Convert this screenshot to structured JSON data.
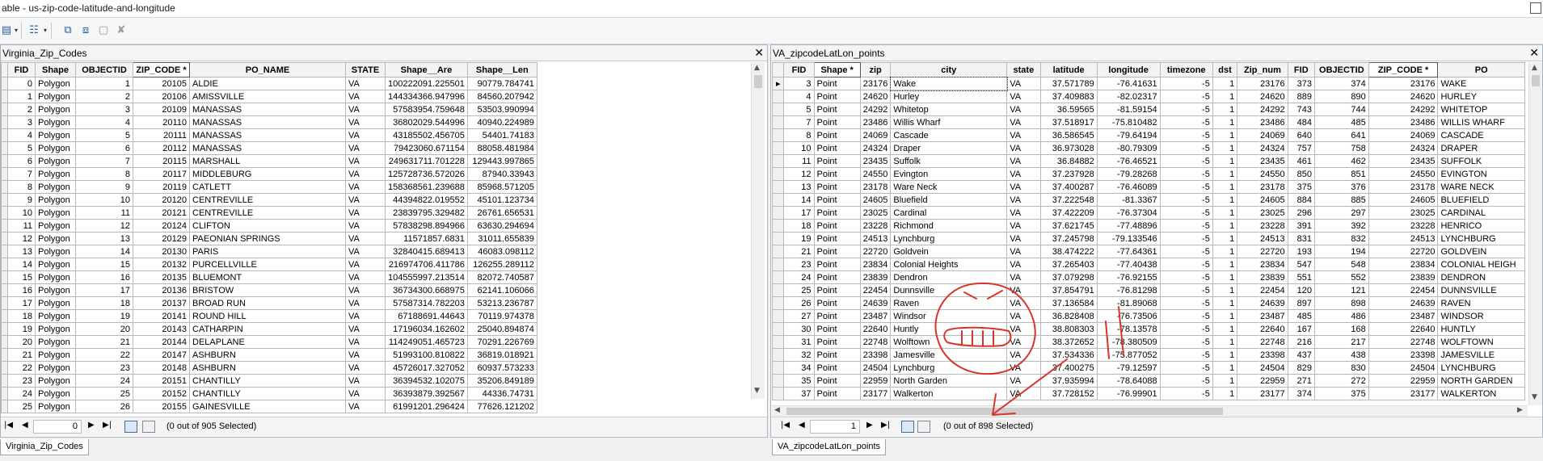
{
  "window": {
    "title": "able - us-zip-code-latitude-and-longitude"
  },
  "left": {
    "title": "Virginia_Zip_Codes",
    "columns": [
      "FID",
      "Shape",
      "OBJECTID",
      "ZIP_CODE *",
      "PO_NAME",
      "STATE",
      "Shape__Are",
      "Shape__Len"
    ],
    "rows": [
      [
        "0",
        "Polygon",
        "1",
        "20105",
        "ALDIE",
        "VA",
        "100222091.225501",
        "90779.784741"
      ],
      [
        "1",
        "Polygon",
        "2",
        "20106",
        "AMISSVILLE",
        "VA",
        "144334366.947996",
        "84560.207942"
      ],
      [
        "2",
        "Polygon",
        "3",
        "20109",
        "MANASSAS",
        "VA",
        "57583954.759648",
        "53503.990994"
      ],
      [
        "3",
        "Polygon",
        "4",
        "20110",
        "MANASSAS",
        "VA",
        "36802029.544996",
        "40940.224989"
      ],
      [
        "4",
        "Polygon",
        "5",
        "20111",
        "MANASSAS",
        "VA",
        "43185502.456705",
        "54401.74183"
      ],
      [
        "5",
        "Polygon",
        "6",
        "20112",
        "MANASSAS",
        "VA",
        "79423060.671154",
        "88058.481984"
      ],
      [
        "6",
        "Polygon",
        "7",
        "20115",
        "MARSHALL",
        "VA",
        "249631711.701228",
        "129443.997865"
      ],
      [
        "7",
        "Polygon",
        "8",
        "20117",
        "MIDDLEBURG",
        "VA",
        "125728736.572026",
        "87940.33943"
      ],
      [
        "8",
        "Polygon",
        "9",
        "20119",
        "CATLETT",
        "VA",
        "158368561.239688",
        "85968.571205"
      ],
      [
        "9",
        "Polygon",
        "10",
        "20120",
        "CENTREVILLE",
        "VA",
        "44394822.019552",
        "45101.123734"
      ],
      [
        "10",
        "Polygon",
        "11",
        "20121",
        "CENTREVILLE",
        "VA",
        "23839795.329482",
        "26761.656531"
      ],
      [
        "11",
        "Polygon",
        "12",
        "20124",
        "CLIFTON",
        "VA",
        "57838298.894966",
        "63630.294694"
      ],
      [
        "12",
        "Polygon",
        "13",
        "20129",
        "PAEONIAN SPRINGS",
        "VA",
        "11571857.6831",
        "31011.655839"
      ],
      [
        "13",
        "Polygon",
        "14",
        "20130",
        "PARIS",
        "VA",
        "32840415.689413",
        "46083.098112"
      ],
      [
        "14",
        "Polygon",
        "15",
        "20132",
        "PURCELLVILLE",
        "VA",
        "216974706.411786",
        "126255.289112"
      ],
      [
        "15",
        "Polygon",
        "16",
        "20135",
        "BLUEMONT",
        "VA",
        "104555997.213514",
        "82072.740587"
      ],
      [
        "16",
        "Polygon",
        "17",
        "20136",
        "BRISTOW",
        "VA",
        "36734300.668975",
        "62141.106066"
      ],
      [
        "17",
        "Polygon",
        "18",
        "20137",
        "BROAD RUN",
        "VA",
        "57587314.782203",
        "53213.236787"
      ],
      [
        "18",
        "Polygon",
        "19",
        "20141",
        "ROUND HILL",
        "VA",
        "67188691.44643",
        "70119.974378"
      ],
      [
        "19",
        "Polygon",
        "20",
        "20143",
        "CATHARPIN",
        "VA",
        "17196034.162602",
        "25040.894874"
      ],
      [
        "20",
        "Polygon",
        "21",
        "20144",
        "DELAPLANE",
        "VA",
        "114249051.465723",
        "70291.226769"
      ],
      [
        "21",
        "Polygon",
        "22",
        "20147",
        "ASHBURN",
        "VA",
        "51993100.810822",
        "36819.018921"
      ],
      [
        "22",
        "Polygon",
        "23",
        "20148",
        "ASHBURN",
        "VA",
        "45726017.327052",
        "60937.573233"
      ],
      [
        "23",
        "Polygon",
        "24",
        "20151",
        "CHANTILLY",
        "VA",
        "36394532.102075",
        "35206.849189"
      ],
      [
        "24",
        "Polygon",
        "25",
        "20152",
        "CHANTILLY",
        "VA",
        "36393879.392567",
        "44336.74731"
      ],
      [
        "25",
        "Polygon",
        "26",
        "20155",
        "GAINESVILLE",
        "VA",
        "61991201.296424",
        "77626.121202"
      ]
    ],
    "nav": {
      "record": "0",
      "selection": "(0 out of 905 Selected)"
    },
    "tab_label": "Virginia_Zip_Codes"
  },
  "right": {
    "title": "VA_zipcodeLatLon_points",
    "columns": [
      "FID",
      "Shape *",
      "zip",
      "city",
      "state",
      "latitude",
      "longitude",
      "timezone",
      "dst",
      "Zip_num",
      "FID",
      "OBJECTID",
      "ZIP_CODE *",
      "PO"
    ],
    "rows": [
      [
        "3",
        "Point",
        "23176",
        "Wake",
        "VA",
        "37.571789",
        "-76.41631",
        "-5",
        "1",
        "23176",
        "373",
        "374",
        "23176",
        "WAKE"
      ],
      [
        "4",
        "Point",
        "24620",
        "Hurley",
        "VA",
        "37.409883",
        "-82.02317",
        "-5",
        "1",
        "24620",
        "889",
        "890",
        "24620",
        "HURLEY"
      ],
      [
        "5",
        "Point",
        "24292",
        "Whitetop",
        "VA",
        "36.59565",
        "-81.59154",
        "-5",
        "1",
        "24292",
        "743",
        "744",
        "24292",
        "WHITETOP"
      ],
      [
        "7",
        "Point",
        "23486",
        "Willis Wharf",
        "VA",
        "37.518917",
        "-75.810482",
        "-5",
        "1",
        "23486",
        "484",
        "485",
        "23486",
        "WILLIS WHARF"
      ],
      [
        "8",
        "Point",
        "24069",
        "Cascade",
        "VA",
        "36.586545",
        "-79.64194",
        "-5",
        "1",
        "24069",
        "640",
        "641",
        "24069",
        "CASCADE"
      ],
      [
        "10",
        "Point",
        "24324",
        "Draper",
        "VA",
        "36.973028",
        "-80.79309",
        "-5",
        "1",
        "24324",
        "757",
        "758",
        "24324",
        "DRAPER"
      ],
      [
        "11",
        "Point",
        "23435",
        "Suffolk",
        "VA",
        "36.84882",
        "-76.46521",
        "-5",
        "1",
        "23435",
        "461",
        "462",
        "23435",
        "SUFFOLK"
      ],
      [
        "12",
        "Point",
        "24550",
        "Evington",
        "VA",
        "37.237928",
        "-79.28268",
        "-5",
        "1",
        "24550",
        "850",
        "851",
        "24550",
        "EVINGTON"
      ],
      [
        "13",
        "Point",
        "23178",
        "Ware Neck",
        "VA",
        "37.400287",
        "-76.46089",
        "-5",
        "1",
        "23178",
        "375",
        "376",
        "23178",
        "WARE NECK"
      ],
      [
        "14",
        "Point",
        "24605",
        "Bluefield",
        "VA",
        "37.222548",
        "-81.3367",
        "-5",
        "1",
        "24605",
        "884",
        "885",
        "24605",
        "BLUEFIELD"
      ],
      [
        "17",
        "Point",
        "23025",
        "Cardinal",
        "VA",
        "37.422209",
        "-76.37304",
        "-5",
        "1",
        "23025",
        "296",
        "297",
        "23025",
        "CARDINAL"
      ],
      [
        "18",
        "Point",
        "23228",
        "Richmond",
        "VA",
        "37.621745",
        "-77.48896",
        "-5",
        "1",
        "23228",
        "391",
        "392",
        "23228",
        "HENRICO"
      ],
      [
        "19",
        "Point",
        "24513",
        "Lynchburg",
        "VA",
        "37.245798",
        "-79.133546",
        "-5",
        "1",
        "24513",
        "831",
        "832",
        "24513",
        "LYNCHBURG"
      ],
      [
        "21",
        "Point",
        "22720",
        "Goldvein",
        "VA",
        "38.474222",
        "-77.64361",
        "-5",
        "1",
        "22720",
        "193",
        "194",
        "22720",
        "GOLDVEIN"
      ],
      [
        "23",
        "Point",
        "23834",
        "Colonial Heights",
        "VA",
        "37.265403",
        "-77.40438",
        "-5",
        "1",
        "23834",
        "547",
        "548",
        "23834",
        "COLONIAL HEIGH"
      ],
      [
        "24",
        "Point",
        "23839",
        "Dendron",
        "VA",
        "37.079298",
        "-76.92155",
        "-5",
        "1",
        "23839",
        "551",
        "552",
        "23839",
        "DENDRON"
      ],
      [
        "25",
        "Point",
        "22454",
        "Dunnsville",
        "VA",
        "37.854791",
        "-76.81298",
        "-5",
        "1",
        "22454",
        "120",
        "121",
        "22454",
        "DUNNSVILLE"
      ],
      [
        "26",
        "Point",
        "24639",
        "Raven",
        "VA",
        "37.136584",
        "-81.89068",
        "-5",
        "1",
        "24639",
        "897",
        "898",
        "24639",
        "RAVEN"
      ],
      [
        "27",
        "Point",
        "23487",
        "Windsor",
        "VA",
        "36.828408",
        "-76.73506",
        "-5",
        "1",
        "23487",
        "485",
        "486",
        "23487",
        "WINDSOR"
      ],
      [
        "30",
        "Point",
        "22640",
        "Huntly",
        "VA",
        "38.808303",
        "-78.13578",
        "-5",
        "1",
        "22640",
        "167",
        "168",
        "22640",
        "HUNTLY"
      ],
      [
        "31",
        "Point",
        "22748",
        "Wolftown",
        "VA",
        "38.372652",
        "-78.380509",
        "-5",
        "1",
        "22748",
        "216",
        "217",
        "22748",
        "WOLFTOWN"
      ],
      [
        "32",
        "Point",
        "23398",
        "Jamesville",
        "VA",
        "37.534336",
        "-75.877052",
        "-5",
        "1",
        "23398",
        "437",
        "438",
        "23398",
        "JAMESVILLE"
      ],
      [
        "34",
        "Point",
        "24504",
        "Lynchburg",
        "VA",
        "37.400275",
        "-79.12597",
        "-5",
        "1",
        "24504",
        "829",
        "830",
        "24504",
        "LYNCHBURG"
      ],
      [
        "35",
        "Point",
        "22959",
        "North Garden",
        "VA",
        "37.935994",
        "-78.64088",
        "-5",
        "1",
        "22959",
        "271",
        "272",
        "22959",
        "NORTH GARDEN"
      ],
      [
        "37",
        "Point",
        "23177",
        "Walkerton",
        "VA",
        "37.728152",
        "-76.99901",
        "-5",
        "1",
        "23177",
        "374",
        "375",
        "23177",
        "WALKERTON"
      ]
    ],
    "nav": {
      "record": "1",
      "selection": "(0 out of 898 Selected)"
    },
    "tab_label": "VA_zipcodeLatLon_points"
  },
  "annotation": {
    "stroke_color": "#d9342b",
    "figure": "hand-drawn face and arrow"
  }
}
